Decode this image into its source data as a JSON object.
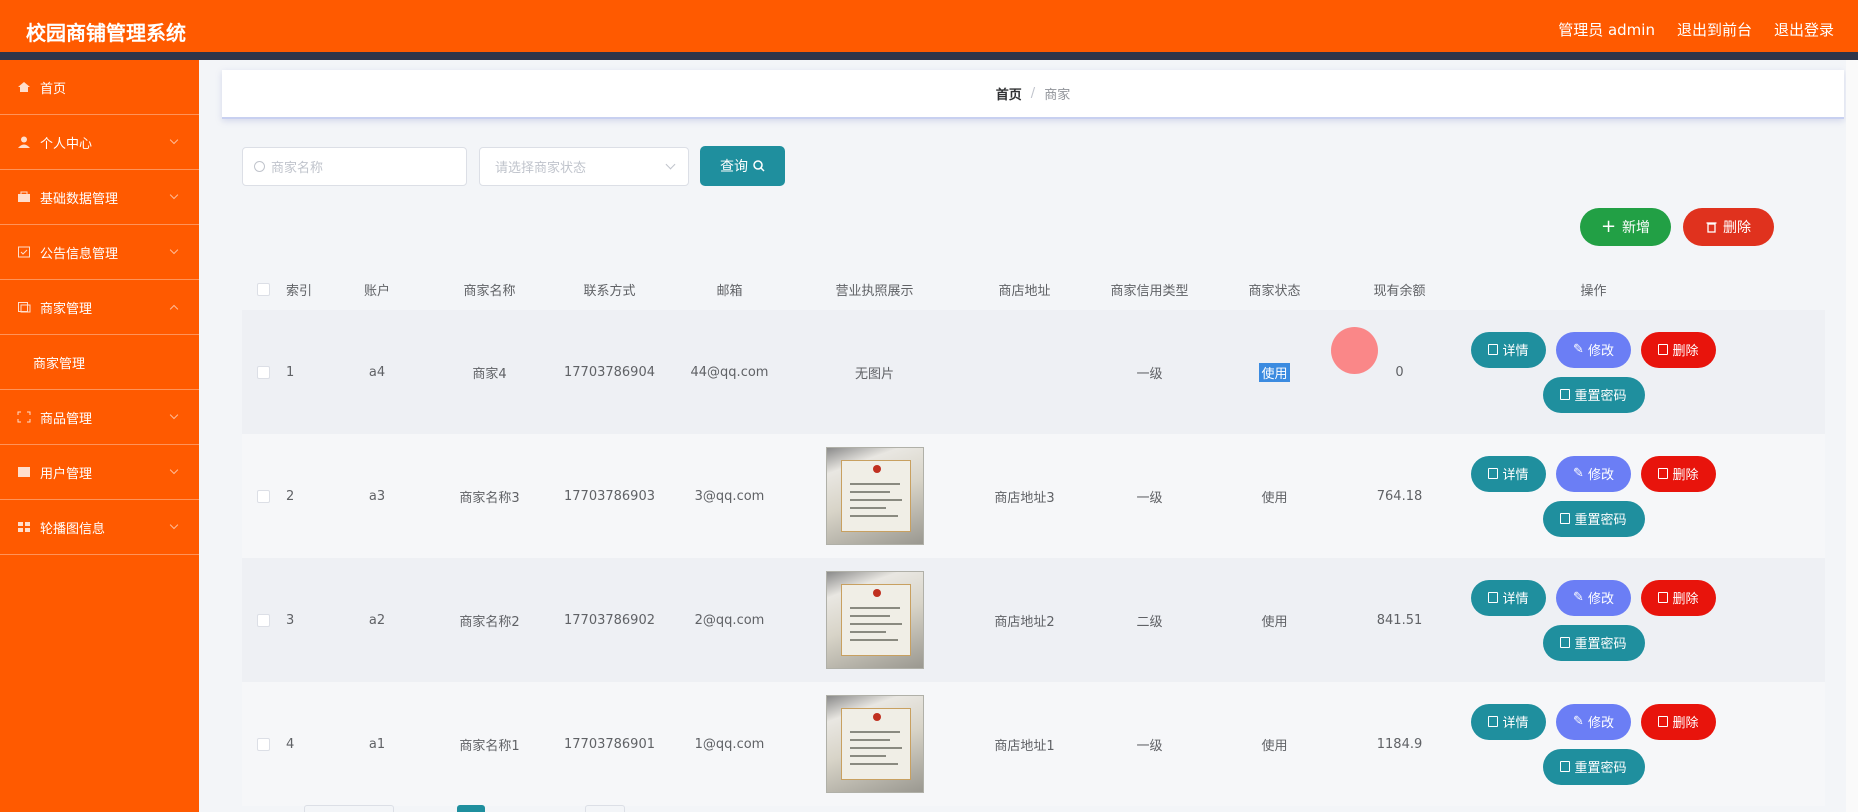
{
  "header": {
    "app_title": "校园商铺管理系统",
    "links": [
      "管理员 admin",
      "退出到前台",
      "退出登录"
    ]
  },
  "sidebar": {
    "items": [
      {
        "label": "首页",
        "icon": "home-icon"
      },
      {
        "label": "个人中心",
        "icon": "user-icon"
      },
      {
        "label": "基础数据管理",
        "icon": "database-icon"
      },
      {
        "label": "公告信息管理",
        "icon": "notice-icon"
      },
      {
        "label": "商家管理",
        "icon": "shop-icon"
      },
      {
        "label": "商家管理",
        "icon": "submenu"
      },
      {
        "label": "商品管理",
        "icon": "goods-icon"
      },
      {
        "label": "用户管理",
        "icon": "users-icon"
      },
      {
        "label": "轮播图信息",
        "icon": "carousel-icon"
      }
    ]
  },
  "breadcrumb": {
    "home": "首页",
    "separator": "/",
    "current": "商家"
  },
  "search": {
    "name_placeholder": "商家名称",
    "state_placeholder": "请选择商家状态",
    "query_label": "查询"
  },
  "toolbar": {
    "add_label": "新增",
    "delete_label": "删除"
  },
  "table": {
    "headers": [
      "索引",
      "账户",
      "商家名称",
      "联系方式",
      "邮箱",
      "营业执照展示",
      "商店地址",
      "商家信用类型",
      "商家状态",
      "现有余额",
      "操作"
    ],
    "rows": [
      {
        "index": "1",
        "account": "a4",
        "name": "商家4",
        "phone": "17703786904",
        "email": "44@qq.com",
        "license": "无图片",
        "address": "",
        "credit": "一级",
        "state": "使用",
        "balance": "0"
      },
      {
        "index": "2",
        "account": "a3",
        "name": "商家名称3",
        "phone": "17703786903",
        "email": "3@qq.com",
        "license": "",
        "address": "商店地址3",
        "credit": "一级",
        "state": "使用",
        "balance": "764.18"
      },
      {
        "index": "3",
        "account": "a2",
        "name": "商家名称2",
        "phone": "17703786902",
        "email": "2@qq.com",
        "license": "",
        "address": "商店地址2",
        "credit": "二级",
        "state": "使用",
        "balance": "841.51"
      },
      {
        "index": "4",
        "account": "a1",
        "name": "商家名称1",
        "phone": "17703786901",
        "email": "1@qq.com",
        "license": "",
        "address": "商店地址1",
        "credit": "一级",
        "state": "使用",
        "balance": "1184.9"
      }
    ],
    "ops": {
      "detail": "详情",
      "edit": "修改",
      "delete": "删除",
      "reset": "重置密码"
    }
  },
  "colors": {
    "brand": "#ff5a00",
    "teal": "#1f8f9e",
    "green": "#22a045",
    "red": "#e0321e",
    "purple": "#6b7ef5"
  }
}
